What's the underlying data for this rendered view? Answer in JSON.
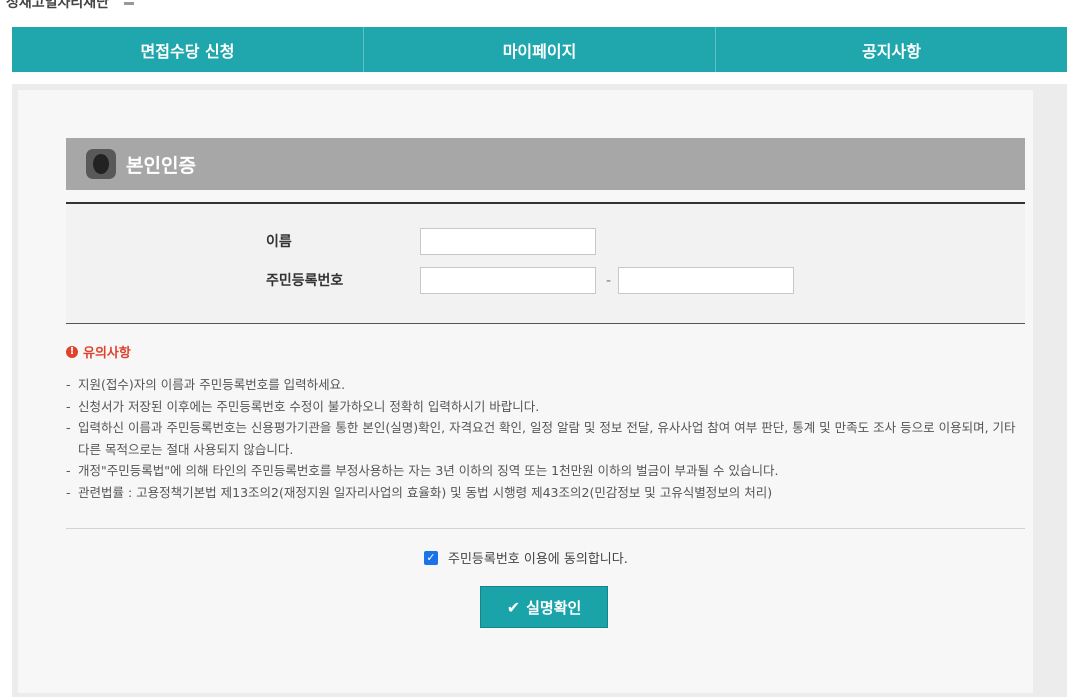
{
  "site": {
    "logo_text": "정새고일자리재단"
  },
  "nav": {
    "items": [
      {
        "label": "면접수당 신청"
      },
      {
        "label": "마이페이지"
      },
      {
        "label": "공지사항"
      }
    ]
  },
  "section": {
    "title": "본인인증",
    "icon": "identity-icon"
  },
  "form": {
    "name_label": "이름",
    "name_value": "",
    "rrn_label": "주민등록번호",
    "rrn_front_value": "",
    "rrn_back_value": "",
    "dash": "-"
  },
  "notice": {
    "title": "유의사항",
    "icon": "warning-icon",
    "items": [
      "지원(접수)자의 이름과 주민등록번호를 입력하세요.",
      "신청서가 저장된 이후에는 주민등록번호 수정이 불가하오니 정확히 입력하시기 바랍니다.",
      "입력하신 이름과 주민등록번호는 신용평가기관을 통한 본인(실명)확인, 자격요건 확인, 일정 알람 및 정보 전달, 유사사업 참여 여부 판단, 통계 및 만족도 조사 등으로 이용되며, 기타 다른 목적으로는 절대 사용되지 않습니다.",
      "개정\"주민등록법\"에 의해 타인의 주민등록번호를 부정사용하는 자는 3년 이하의 징역 또는 1천만원 이하의 벌금이 부과될 수 있습니다.",
      "관련법률 : 고용정책기본법 제13조의2(재정지원 일자리사업의 효율화) 및 동법 시행령 제43조의2(민감정보 및 고유식별정보의 처리)"
    ]
  },
  "agree": {
    "label": "주민등록번호 이용에 동의합니다.",
    "checked": true
  },
  "confirm_button": {
    "label": "실명확인",
    "icon": "check-icon"
  },
  "colors": {
    "nav": "#1fa7ad",
    "button": "#1aa3a8",
    "warning": "#e0432d",
    "section_bar": "#a7a7a7"
  }
}
